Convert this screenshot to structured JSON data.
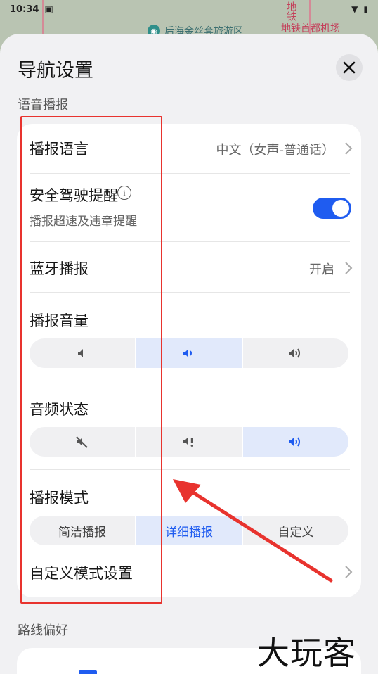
{
  "status_bar": {
    "time": "10:34"
  },
  "map": {
    "poi_label": "后海金丝套旅游区",
    "metro_label": "地铁首都机场",
    "metro_vertical": "地铁"
  },
  "sheet": {
    "title": "导航设置"
  },
  "sections": {
    "voice": "语音播报",
    "route": "路线偏好"
  },
  "settings": {
    "language": {
      "title": "播报语言",
      "value": "中文（女声-普通话）"
    },
    "safety": {
      "title": "安全驾驶提醒",
      "subtitle": "播报超速及违章提醒",
      "enabled": true
    },
    "bluetooth": {
      "title": "蓝牙播报",
      "value": "开启"
    },
    "volume": {
      "title": "播报音量",
      "selected": 1,
      "options": [
        "volume-low-icon",
        "volume-medium-icon",
        "volume-high-icon"
      ]
    },
    "audio_state": {
      "title": "音频状态",
      "selected": 2,
      "options": [
        "mute-icon",
        "alert-icon",
        "volume-icon"
      ]
    },
    "mode": {
      "title": "播报模式",
      "options": [
        "简洁播报",
        "详细播报",
        "自定义"
      ],
      "selected": 1
    },
    "custom_mode": {
      "title": "自定义模式设置"
    }
  },
  "watermark": "大玩客",
  "colors": {
    "accent": "#1f5cf0",
    "annotation": "#e8332e"
  }
}
